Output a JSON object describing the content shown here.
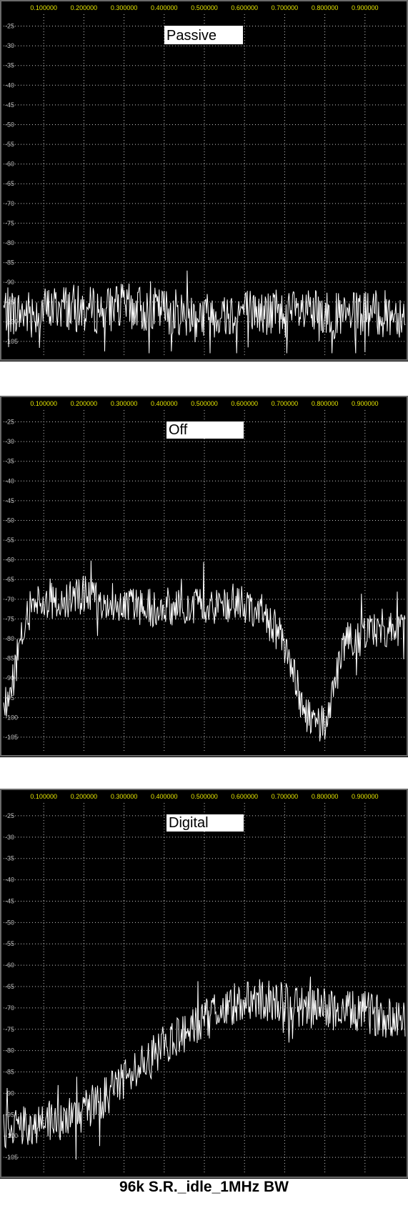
{
  "caption": "96k S.R._idle_1MHz BW",
  "colors": {
    "background": "#000000",
    "grid": "#c8c8c8",
    "x_tick_text": "#e6e600",
    "y_tick_text": "#c0c0c0",
    "trace": "#ffffff",
    "label_box": "#ffffff",
    "label_text": "#000000"
  },
  "chart_data": [
    {
      "type": "line",
      "title": "Passive",
      "xlabel": "",
      "ylabel": "",
      "xlim": [
        0,
        1.0
      ],
      "ylim": [
        -109,
        -22
      ],
      "x_ticks": [
        "0.100000",
        "0.200000",
        "0.300000",
        "0.400000",
        "0.500000",
        "0.600000",
        "0.700000",
        "0.800000",
        "0.900000"
      ],
      "x_tick_values": [
        0.1,
        0.2,
        0.3,
        0.4,
        0.5,
        0.6,
        0.7,
        0.8,
        0.9
      ],
      "y_ticks": [
        "-25",
        "-30",
        "-35",
        "-40",
        "-45",
        "-50",
        "-55",
        "-60",
        "-65",
        "-70",
        "-75",
        "-80",
        "-85",
        "-90",
        "-95",
        "-100",
        "-105"
      ],
      "grid": true,
      "series": [
        {
          "x": [
            0,
            0.05,
            0.1,
            0.15,
            0.2,
            0.25,
            0.3,
            0.35,
            0.4,
            0.45,
            0.5,
            0.55,
            0.6,
            0.65,
            0.7,
            0.75,
            0.8,
            0.85,
            0.9,
            0.95,
            1.0
          ],
          "values": [
            -97,
            -98,
            -97,
            -96,
            -97,
            -97,
            -96,
            -97,
            -97,
            -98,
            -98,
            -98,
            -97,
            -98,
            -98,
            -98,
            -98,
            -99,
            -98,
            -98,
            -98
          ],
          "noise": 6
        }
      ]
    },
    {
      "type": "line",
      "title": "Off",
      "xlabel": "",
      "ylabel": "",
      "xlim": [
        0,
        1.0
      ],
      "ylim": [
        -109,
        -22
      ],
      "x_ticks": [
        "0.100000",
        "0.200000",
        "0.300000",
        "0.400000",
        "0.500000",
        "0.600000",
        "0.700000",
        "0.800000",
        "0.900000"
      ],
      "x_tick_values": [
        0.1,
        0.2,
        0.3,
        0.4,
        0.5,
        0.6,
        0.7,
        0.8,
        0.9
      ],
      "y_ticks": [
        "-25",
        "-30",
        "-35",
        "-40",
        "-45",
        "-50",
        "-55",
        "-60",
        "-65",
        "-70",
        "-75",
        "-80",
        "-85",
        "-90",
        "-95",
        "-100",
        "-105"
      ],
      "grid": true,
      "series": [
        {
          "x": [
            0,
            0.02,
            0.04,
            0.06,
            0.08,
            0.1,
            0.15,
            0.2,
            0.25,
            0.3,
            0.35,
            0.4,
            0.45,
            0.5,
            0.55,
            0.6,
            0.65,
            0.68,
            0.7,
            0.72,
            0.74,
            0.76,
            0.78,
            0.8,
            0.82,
            0.84,
            0.86,
            0.9,
            0.95,
            1.0
          ],
          "values": [
            -98,
            -92,
            -82,
            -74,
            -70,
            -70,
            -71,
            -69,
            -70,
            -71,
            -72,
            -72,
            -72,
            -72,
            -71,
            -71,
            -74,
            -78,
            -82,
            -88,
            -96,
            -100,
            -103,
            -101,
            -94,
            -85,
            -80,
            -78,
            -77,
            -78
          ],
          "noise": 5
        }
      ]
    },
    {
      "type": "line",
      "title": "Digital",
      "xlabel": "",
      "ylabel": "",
      "xlim": [
        0,
        1.0
      ],
      "ylim": [
        -109,
        -22
      ],
      "x_ticks": [
        "0.100000",
        "0.200000",
        "0.300000",
        "0.400000",
        "0.500000",
        "0.600000",
        "0.700000",
        "0.800000",
        "0.900000"
      ],
      "x_tick_values": [
        0.1,
        0.2,
        0.3,
        0.4,
        0.5,
        0.6,
        0.7,
        0.8,
        0.9
      ],
      "y_ticks": [
        "-25",
        "-30",
        "-35",
        "-40",
        "-45",
        "-50",
        "-55",
        "-60",
        "-65",
        "-70",
        "-75",
        "-80",
        "-85",
        "-90",
        "-95",
        "-100",
        "-105"
      ],
      "grid": true,
      "series": [
        {
          "x": [
            0,
            0.05,
            0.1,
            0.15,
            0.2,
            0.25,
            0.3,
            0.35,
            0.4,
            0.45,
            0.5,
            0.55,
            0.6,
            0.65,
            0.7,
            0.75,
            0.8,
            0.85,
            0.9,
            0.95,
            1.0
          ],
          "values": [
            -99,
            -98,
            -97,
            -96,
            -94,
            -91,
            -87,
            -83,
            -79,
            -76,
            -73,
            -70,
            -68,
            -68,
            -69,
            -70,
            -70,
            -71,
            -71,
            -72,
            -72
          ],
          "noise": 5
        }
      ]
    }
  ]
}
